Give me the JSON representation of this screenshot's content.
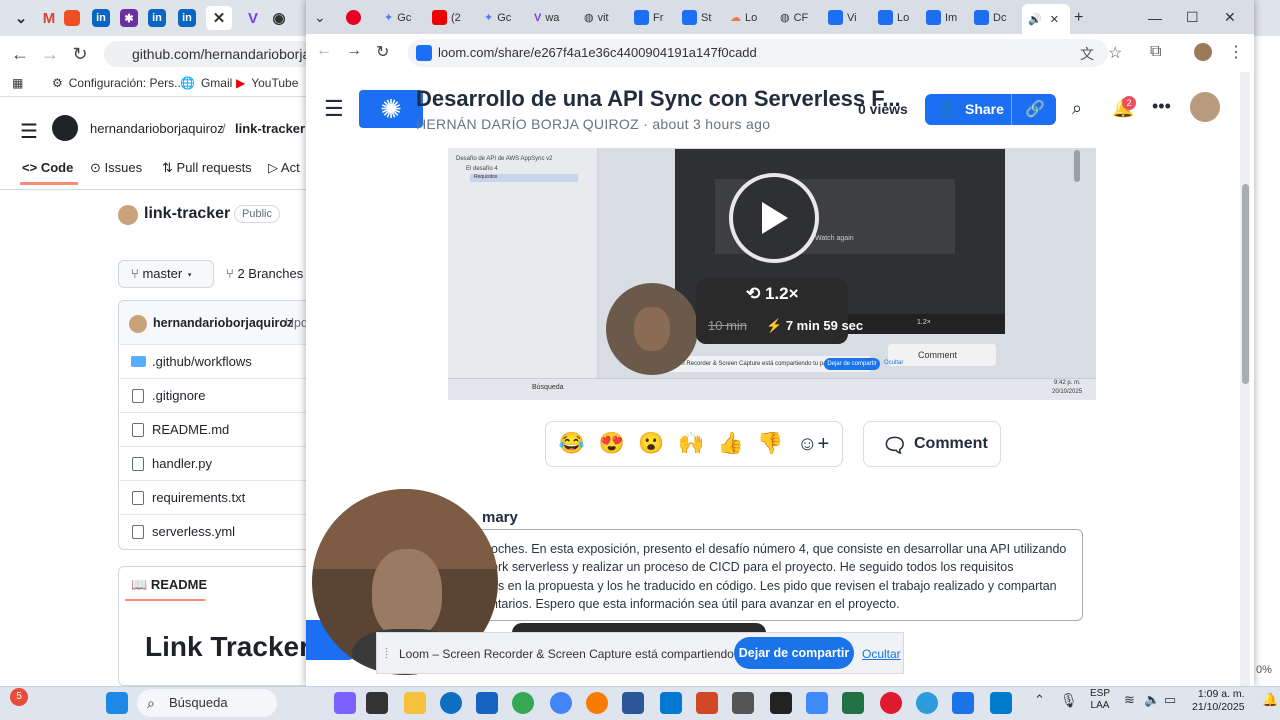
{
  "background_window": {
    "url": "github.com/hernandarioborjaquir",
    "bookmarks": [
      "Configuración: Pers...",
      "Gmail",
      "YouTube"
    ],
    "github": {
      "owner": "hernandarioborjaquiroz",
      "repo": "link-tracker",
      "nav": {
        "code": "Code",
        "issues": "Issues",
        "pulls": "Pull requests",
        "actions": "Act"
      },
      "repo_title": "link-tracker",
      "visibility": "Public",
      "branch": "master",
      "branches": "2 Branches",
      "commit_author": "hernandarioborjaquiroz",
      "commit_msg": "Upd",
      "files": [
        ".github/workflows",
        ".gitignore",
        "README.md",
        "handler.py",
        "requirements.txt",
        "serverless.yml"
      ],
      "readme_tab": "README",
      "readme_heading": "Link Tracker –"
    }
  },
  "front_window": {
    "tabs": [
      "Gc",
      "(2",
      "Gc",
      "wa",
      "vit",
      "Fr",
      "St",
      "Lo",
      "CF",
      "Vi",
      "Lo",
      "Im",
      "Dc"
    ],
    "url": "loom.com/share/e267f4a1e36c4400904191a147f0cadd",
    "loom": {
      "title": "Desarrollo de una API Sync con Serverless F...",
      "author": "HERNÁN DARÍO BORJA QUIROZ",
      "time": "about 3 hours ago",
      "views": "0 views",
      "share_label": "Share",
      "notification_count": "2",
      "video": {
        "speed": "1.2×",
        "orig_time": "10 min",
        "new_time": "7 min 59 sec",
        "watch_again": "Watch again",
        "inner_comment": "Comment",
        "inner_share_text": "Loom – Screen Recorder & Screen Capture está compartiendo tu pantalla.",
        "inner_stop": "Dejar de compartir",
        "inner_hide": "Ocultar",
        "inner_search": "Búsqueda",
        "inner_speed": "1.2×",
        "inner_time": "9:42 p. m.",
        "inner_date": "20/10/2025",
        "side_title": "Desafío de API de AWS AppSync v2",
        "side_item": "El desafío 4",
        "side_sub": "Requisitos"
      },
      "reactions": [
        "😂",
        "😍",
        "😮",
        "🙌",
        "👍",
        "👎"
      ],
      "comment_label": "Comment",
      "summary_title": "mary",
      "summary_lines": [
        "oches. En esta exposición, presento el desafío número 4, que consiste en desarrollar una API utilizando",
        "ork serverless y realizar un proceso de CICD para el proyecto. He seguido todos los requisitos",
        "os en la propuesta y los he traducido en código. Les pido que revisen el trabajo realizado y compartan",
        "ntarios. Espero que esta información sea útil para avanzar en el proyecto."
      ]
    },
    "share_bar": {
      "text": "Loom – Screen Recorder & Screen Capture está compartiendo tu pantalla.",
      "stop": "Dejar de compartir",
      "hide": "Ocultar"
    }
  },
  "taskbar": {
    "search": "Búsqueda",
    "notif_badge": "5",
    "lang": "ESP",
    "lang2": "LAA",
    "time": "1:09 a. m.",
    "date": "21/10/2025",
    "zoom_edge": "0%"
  },
  "colors": {
    "loom_blue": "#1c6ef2",
    "share_blue": "#1a73e8",
    "folder_blue": "#54aeff"
  }
}
